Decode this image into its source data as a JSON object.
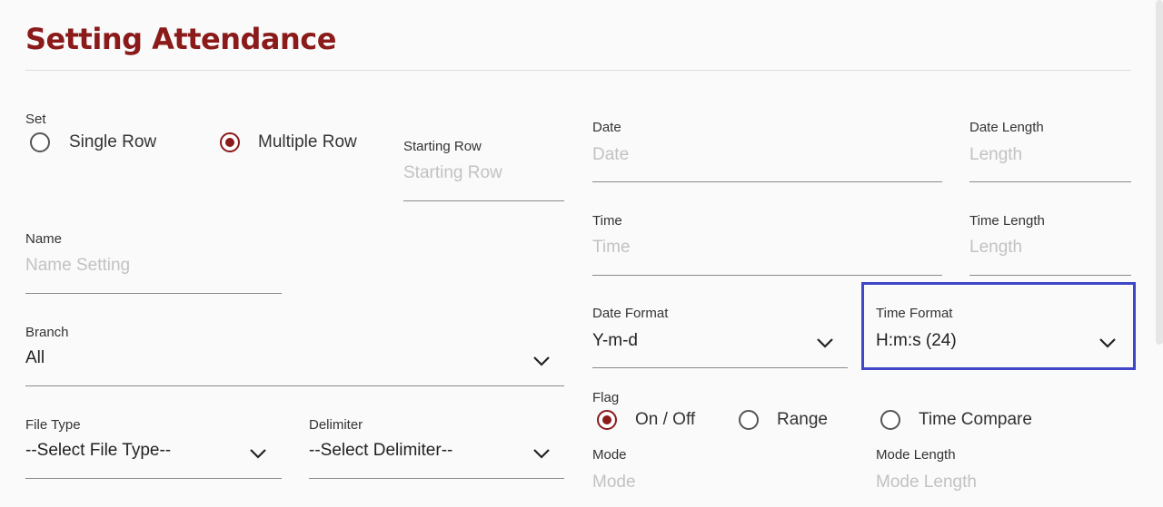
{
  "page": {
    "title": "Setting Attendance"
  },
  "set": {
    "label": "Set",
    "options": [
      {
        "label": "Single Row",
        "selected": false
      },
      {
        "label": "Multiple Row",
        "selected": true
      }
    ]
  },
  "starting_row": {
    "label": "Starting Row",
    "placeholder": "Starting Row"
  },
  "name": {
    "label": "Name",
    "placeholder": "Name Setting"
  },
  "branch": {
    "label": "Branch",
    "value": "All"
  },
  "file_type": {
    "label": "File Type",
    "value": "--Select File Type--"
  },
  "delimiter": {
    "label": "Delimiter",
    "value": "--Select Delimiter--"
  },
  "date": {
    "label": "Date",
    "placeholder": "Date"
  },
  "date_length": {
    "label": "Date Length",
    "placeholder": "Length"
  },
  "time": {
    "label": "Time",
    "placeholder": "Time"
  },
  "time_length": {
    "label": "Time Length",
    "placeholder": "Length"
  },
  "date_format": {
    "label": "Date Format",
    "value": "Y-m-d"
  },
  "time_format": {
    "label": "Time Format",
    "value": "H:m:s (24)"
  },
  "flag": {
    "label": "Flag",
    "options": [
      {
        "label": "On / Off",
        "selected": true
      },
      {
        "label": "Range",
        "selected": false
      },
      {
        "label": "Time Compare",
        "selected": false
      }
    ]
  },
  "mode": {
    "label": "Mode",
    "placeholder": "Mode"
  },
  "mode_length": {
    "label": "Mode Length",
    "placeholder": "Mode Length"
  },
  "colors": {
    "accent": "#8b1a1a",
    "focus": "#3f46c8"
  }
}
